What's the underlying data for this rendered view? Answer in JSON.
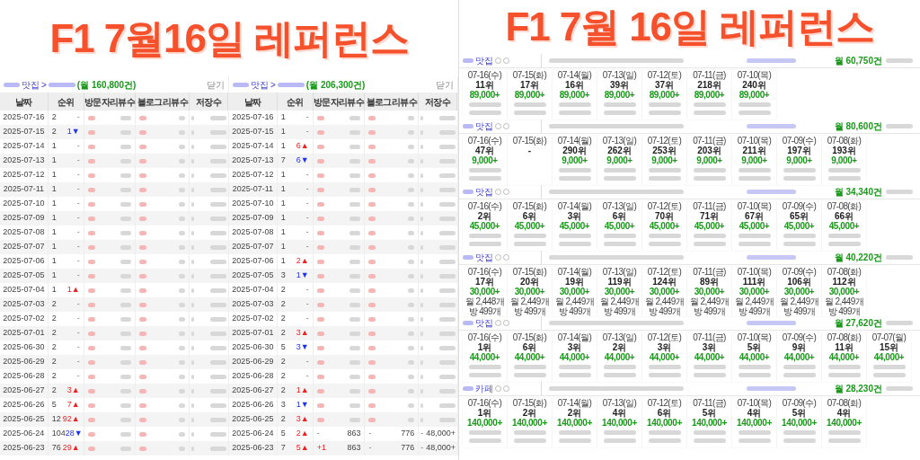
{
  "titles": [
    "F1 7월16일 레퍼런스",
    "F1 7월 16일 레퍼런스"
  ],
  "tables": [
    {
      "place": "맛집",
      "separator": ">",
      "monthly": "(월 160,800건)",
      "close": "닫기",
      "columns": [
        "날짜",
        "순위",
        "방문자리뷰수",
        "블로그리뷰수",
        "저장수"
      ],
      "rows": [
        {
          "date": "2025-07-16",
          "rank": "2",
          "change": {
            "text": "-"
          }
        },
        {
          "date": "2025-07-15",
          "rank": "2",
          "change": {
            "text": "1▼",
            "color": "#2233ee"
          }
        },
        {
          "date": "2025-07-14",
          "rank": "1",
          "change": {
            "text": "-"
          }
        },
        {
          "date": "2025-07-13",
          "rank": "1",
          "change": {
            "text": "-"
          }
        },
        {
          "date": "2025-07-12",
          "rank": "1",
          "change": {
            "text": "-"
          }
        },
        {
          "date": "2025-07-11",
          "rank": "1",
          "change": {
            "text": "-"
          }
        },
        {
          "date": "2025-07-10",
          "rank": "1",
          "change": {
            "text": "-"
          }
        },
        {
          "date": "2025-07-09",
          "rank": "1",
          "change": {
            "text": "-"
          }
        },
        {
          "date": "2025-07-08",
          "rank": "1",
          "change": {
            "text": "-"
          }
        },
        {
          "date": "2025-07-07",
          "rank": "1",
          "change": {
            "text": "-"
          }
        },
        {
          "date": "2025-07-06",
          "rank": "1",
          "change": {
            "text": "-"
          }
        },
        {
          "date": "2025-07-05",
          "rank": "1",
          "change": {
            "text": "-"
          }
        },
        {
          "date": "2025-07-04",
          "rank": "1",
          "change": {
            "text": "1▲",
            "color": "#ee2222"
          }
        },
        {
          "date": "2025-07-03",
          "rank": "2",
          "change": {
            "text": "-"
          }
        },
        {
          "date": "2025-07-02",
          "rank": "2",
          "change": {
            "text": "-"
          }
        },
        {
          "date": "2025-07-01",
          "rank": "2",
          "change": {
            "text": "-"
          }
        },
        {
          "date": "2025-06-30",
          "rank": "2",
          "change": {
            "text": "-"
          }
        },
        {
          "date": "2025-06-29",
          "rank": "2",
          "change": {
            "text": "-"
          }
        },
        {
          "date": "2025-06-28",
          "rank": "2",
          "change": {
            "text": "-"
          }
        },
        {
          "date": "2025-06-27",
          "rank": "2",
          "change": {
            "text": "3▲",
            "color": "#ee2222"
          }
        },
        {
          "date": "2025-06-26",
          "rank": "5",
          "change": {
            "text": "7▲",
            "color": "#ee2222"
          }
        },
        {
          "date": "2025-06-25",
          "rank": "12",
          "change": {
            "text": "92▲",
            "color": "#ee2222"
          }
        },
        {
          "date": "2025-06-24",
          "rank": "104",
          "change": {
            "text": "28▼",
            "color": "#2233ee"
          }
        },
        {
          "date": "2025-06-23",
          "rank": "76",
          "change": {
            "text": "29▲",
            "color": "#ee2222"
          }
        }
      ]
    },
    {
      "place": "맛집",
      "separator": ">",
      "monthly": "(월 206,300건)",
      "close": "닫기",
      "columns": [
        "날짜",
        "순위",
        "방문자리뷰수",
        "블로그리뷰수",
        "저장수"
      ],
      "rows": [
        {
          "date": "2025-07-16",
          "rank": "1",
          "change": {
            "text": "-"
          }
        },
        {
          "date": "2025-07-15",
          "rank": "1",
          "change": {
            "text": "-"
          }
        },
        {
          "date": "2025-07-14",
          "rank": "1",
          "change": {
            "text": "6▲",
            "color": "#ee2222"
          }
        },
        {
          "date": "2025-07-13",
          "rank": "7",
          "change": {
            "text": "6▼",
            "color": "#2233ee"
          }
        },
        {
          "date": "2025-07-12",
          "rank": "1",
          "change": {
            "text": "-"
          }
        },
        {
          "date": "2025-07-11",
          "rank": "1",
          "change": {
            "text": "-"
          }
        },
        {
          "date": "2025-07-10",
          "rank": "1",
          "change": {
            "text": "-"
          }
        },
        {
          "date": "2025-07-09",
          "rank": "1",
          "change": {
            "text": "-"
          }
        },
        {
          "date": "2025-07-08",
          "rank": "1",
          "change": {
            "text": "-"
          }
        },
        {
          "date": "2025-07-07",
          "rank": "1",
          "change": {
            "text": "-"
          }
        },
        {
          "date": "2025-07-06",
          "rank": "1",
          "change": {
            "text": "2▲",
            "color": "#ee2222"
          }
        },
        {
          "date": "2025-07-05",
          "rank": "3",
          "change": {
            "text": "1▼",
            "color": "#2233ee"
          }
        },
        {
          "date": "2025-07-04",
          "rank": "2",
          "change": {
            "text": "-"
          }
        },
        {
          "date": "2025-07-03",
          "rank": "2",
          "change": {
            "text": "-"
          }
        },
        {
          "date": "2025-07-02",
          "rank": "2",
          "change": {
            "text": "-"
          }
        },
        {
          "date": "2025-07-01",
          "rank": "2",
          "change": {
            "text": "3▲",
            "color": "#ee2222"
          }
        },
        {
          "date": "2025-06-30",
          "rank": "5",
          "change": {
            "text": "3▼",
            "color": "#2233ee"
          }
        },
        {
          "date": "2025-06-29",
          "rank": "2",
          "change": {
            "text": "-"
          }
        },
        {
          "date": "2025-06-28",
          "rank": "2",
          "change": {
            "text": "-"
          }
        },
        {
          "date": "2025-06-27",
          "rank": "2",
          "change": {
            "text": "1▲",
            "color": "#ee2222"
          }
        },
        {
          "date": "2025-06-26",
          "rank": "3",
          "change": {
            "text": "1▼",
            "color": "#2233ee"
          }
        },
        {
          "date": "2025-06-25",
          "rank": "2",
          "change": {
            "text": "3▲",
            "color": "#ee2222"
          }
        },
        {
          "date": "2025-06-24",
          "rank": "5",
          "change": {
            "text": "2▲",
            "color": "#ee2222"
          },
          "visitor_delta": "-",
          "visitor": "863",
          "blog_delta": "-",
          "blog": "776",
          "save_delta": "-",
          "save": "48,000+"
        },
        {
          "date": "2025-06-23",
          "rank": "7",
          "change": {
            "text": "5▲",
            "color": "#ee2222"
          },
          "visitor_delta": "+1",
          "visitor": "863",
          "blog_delta": "-",
          "blog": "776",
          "save_delta": "-",
          "save": "48,000+"
        }
      ]
    }
  ],
  "groups": [
    {
      "name": "맛집",
      "monthly": "월 60,750건",
      "days": [
        {
          "date": "07-16(수)",
          "rank": "11위",
          "price": "89,000+"
        },
        {
          "date": "07-15(화)",
          "rank": "17위",
          "price": "89,000+"
        },
        {
          "date": "07-14(월)",
          "rank": "16위",
          "price": "89,000+"
        },
        {
          "date": "07-13(일)",
          "rank": "39위",
          "price": "89,000+"
        },
        {
          "date": "07-12(토)",
          "rank": "37위",
          "price": "89,000+"
        },
        {
          "date": "07-11(금)",
          "rank": "218위",
          "price": "89,000+"
        },
        {
          "date": "07-10(목)",
          "rank": "240위",
          "price": "89,000+"
        }
      ]
    },
    {
      "name": "맛집",
      "monthly": "월 80,600건",
      "days": [
        {
          "date": "07-16(수)",
          "rank": "47위",
          "price": "9,000+"
        },
        {
          "date": "07-15(화)",
          "rank": "-"
        },
        {
          "date": "07-14(월)",
          "rank": "290위",
          "price": "9,000+"
        },
        {
          "date": "07-13(일)",
          "rank": "262위",
          "price": "9,000+"
        },
        {
          "date": "07-12(토)",
          "rank": "253위",
          "price": "9,000+"
        },
        {
          "date": "07-11(금)",
          "rank": "203위",
          "price": "9,000+"
        },
        {
          "date": "07-10(목)",
          "rank": "211위",
          "price": "9,000+"
        },
        {
          "date": "07-09(수)",
          "rank": "197위",
          "price": "9,000+"
        },
        {
          "date": "07-08(화)",
          "rank": "193위",
          "price": "9,000+"
        }
      ]
    },
    {
      "name": "맛집",
      "monthly": "월 34,340건",
      "days": [
        {
          "date": "07-16(수)",
          "rank": "2위",
          "price": "45,000+"
        },
        {
          "date": "07-15(화)",
          "rank": "6위",
          "price": "45,000+"
        },
        {
          "date": "07-14(월)",
          "rank": "3위",
          "price": "45,000+"
        },
        {
          "date": "07-13(일)",
          "rank": "6위",
          "price": "45,000+"
        },
        {
          "date": "07-12(토)",
          "rank": "70위",
          "price": "45,000+"
        },
        {
          "date": "07-11(금)",
          "rank": "71위",
          "price": "45,000+"
        },
        {
          "date": "07-10(목)",
          "rank": "67위",
          "price": "45,000+"
        },
        {
          "date": "07-09(수)",
          "rank": "65위",
          "price": "45,000+"
        },
        {
          "date": "07-08(화)",
          "rank": "66위",
          "price": "45,000+"
        }
      ]
    },
    {
      "name": "맛집",
      "monthly": "월 40,220건",
      "days": [
        {
          "date": "07-16(수)",
          "rank": "17위",
          "price": "30,000+",
          "lines": [
            "월 2,448개",
            "방 499개"
          ]
        },
        {
          "date": "07-15(화)",
          "rank": "20위",
          "price": "30,000+",
          "lines": [
            "월 2,449개",
            "방 499개"
          ]
        },
        {
          "date": "07-14(월)",
          "rank": "19위",
          "price": "30,000+",
          "lines": [
            "월 2,449개",
            "방 499개"
          ]
        },
        {
          "date": "07-13(일)",
          "rank": "119위",
          "price": "30,000+",
          "lines": [
            "월 2,449개",
            "방 499개"
          ]
        },
        {
          "date": "07-12(토)",
          "rank": "124위",
          "price": "30,000+",
          "lines": [
            "월 2,449개",
            "방 499개"
          ]
        },
        {
          "date": "07-11(금)",
          "rank": "89위",
          "price": "30,000+",
          "lines": [
            "월 2,449개",
            "방 499개"
          ]
        },
        {
          "date": "07-10(목)",
          "rank": "111위",
          "price": "30,000+",
          "lines": [
            "월 2,449개",
            "방 499개"
          ]
        },
        {
          "date": "07-09(수)",
          "rank": "106위",
          "price": "30,000+",
          "lines": [
            "월 2,449개",
            "방 499개"
          ]
        },
        {
          "date": "07-08(화)",
          "rank": "112위",
          "price": "30,000+",
          "lines": [
            "월 2,449개",
            "방 499개"
          ]
        }
      ]
    },
    {
      "name": "맛집",
      "monthly": "월 27,620건",
      "days": [
        {
          "date": "07-16(수)",
          "rank": "1위",
          "price": "44,000+"
        },
        {
          "date": "07-15(화)",
          "rank": "6위",
          "price": "44,000+"
        },
        {
          "date": "07-14(월)",
          "rank": "3위",
          "price": "44,000+"
        },
        {
          "date": "07-13(일)",
          "rank": "2위",
          "price": "44,000+"
        },
        {
          "date": "07-12(토)",
          "rank": "3위",
          "price": "44,000+"
        },
        {
          "date": "07-11(금)",
          "rank": "3위",
          "price": "44,000+"
        },
        {
          "date": "07-10(목)",
          "rank": "5위",
          "price": "44,000+"
        },
        {
          "date": "07-09(수)",
          "rank": "9위",
          "price": "44,000+"
        },
        {
          "date": "07-08(화)",
          "rank": "11위",
          "price": "44,000+"
        },
        {
          "date": "07-07(월)",
          "rank": "15위",
          "price": "44,000+"
        }
      ]
    },
    {
      "name": "카페",
      "monthly": "월 28,230건",
      "days": [
        {
          "date": "07-16(수)",
          "rank": "1위",
          "price": "140,000+"
        },
        {
          "date": "07-15(화)",
          "rank": "2위",
          "price": "140,000+"
        },
        {
          "date": "07-14(월)",
          "rank": "2위",
          "price": "140,000+"
        },
        {
          "date": "07-13(일)",
          "rank": "4위",
          "price": "140,000+"
        },
        {
          "date": "07-12(토)",
          "rank": "6위",
          "price": "140,000+"
        },
        {
          "date": "07-11(금)",
          "rank": "5위",
          "price": "140,000+"
        },
        {
          "date": "07-10(목)",
          "rank": "4위",
          "price": "140,000+"
        },
        {
          "date": "07-09(수)",
          "rank": "5위",
          "price": "140,000+"
        },
        {
          "date": "07-08(화)",
          "rank": "4위",
          "price": "140,000+"
        }
      ]
    }
  ]
}
